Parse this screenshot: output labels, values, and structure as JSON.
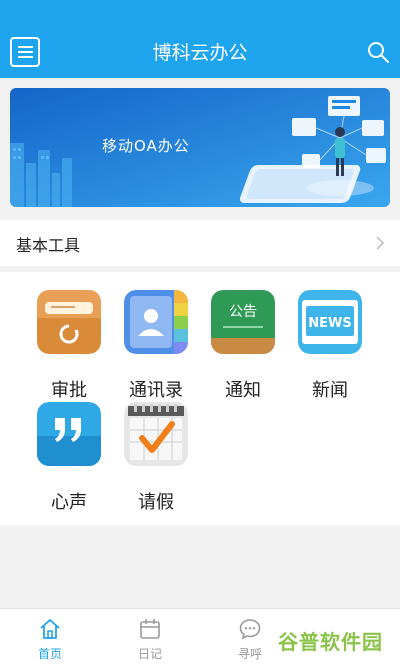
{
  "header": {
    "title": "博科云办公"
  },
  "banner": {
    "text": "移动OA办公"
  },
  "section": {
    "title": "基本工具"
  },
  "tools": [
    {
      "label": "审批",
      "icon": "approval-icon",
      "color": "#d98b3a"
    },
    {
      "label": "通讯录",
      "icon": "contacts-icon",
      "color": "#4f8fe8"
    },
    {
      "label": "通知",
      "icon": "notice-board-icon",
      "color": "#2f9a56"
    },
    {
      "label": "新闻",
      "icon": "news-icon",
      "color": "#3fb4ea"
    },
    {
      "label": "心声",
      "icon": "quote-bubble-icon",
      "color": "#2fa8e6"
    },
    {
      "label": "请假",
      "icon": "calendar-check-icon",
      "color": "#f07f1a"
    }
  ],
  "notice_icon_text": "公告",
  "news_icon_text": "NEWS",
  "tabs": [
    {
      "label": "首页",
      "icon": "home-icon",
      "active": true
    },
    {
      "label": "日记",
      "icon": "diary-icon",
      "active": false
    },
    {
      "label": "寻呼",
      "icon": "chat-icon",
      "active": false
    }
  ],
  "watermark": {
    "text": "谷普软件园"
  },
  "colors": {
    "accent": "#1fa4ee"
  }
}
